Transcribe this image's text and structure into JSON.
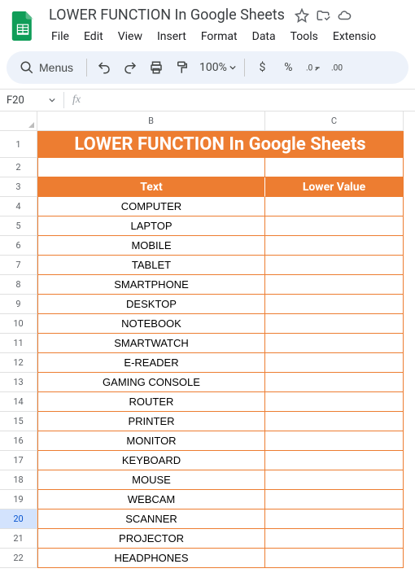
{
  "doc": {
    "title": "LOWER FUNCTION In Google Sheets"
  },
  "menus": {
    "file": "File",
    "edit": "Edit",
    "view": "View",
    "insert": "Insert",
    "format": "Format",
    "data": "Data",
    "tools": "Tools",
    "extensions": "Extensio"
  },
  "toolbar": {
    "search_label": "Menus",
    "zoom": "100%",
    "currency": "$",
    "percent": "%"
  },
  "namebox": {
    "value": "F20",
    "fx": "fx"
  },
  "columns": {
    "B": "B",
    "C": "C"
  },
  "sheet": {
    "title": "LOWER FUNCTION In Google Sheets",
    "header_text": "Text",
    "header_value": "Lower Value",
    "rows": [
      {
        "n": "1"
      },
      {
        "n": "2"
      },
      {
        "n": "3"
      },
      {
        "n": "4",
        "text": "COMPUTER",
        "value": ""
      },
      {
        "n": "5",
        "text": "LAPTOP",
        "value": ""
      },
      {
        "n": "6",
        "text": "MOBILE",
        "value": ""
      },
      {
        "n": "7",
        "text": "TABLET",
        "value": ""
      },
      {
        "n": "8",
        "text": "SMARTPHONE",
        "value": ""
      },
      {
        "n": "9",
        "text": "DESKTOP",
        "value": ""
      },
      {
        "n": "10",
        "text": "NOTEBOOK",
        "value": ""
      },
      {
        "n": "11",
        "text": "SMARTWATCH",
        "value": ""
      },
      {
        "n": "12",
        "text": "E-READER",
        "value": ""
      },
      {
        "n": "13",
        "text": "GAMING CONSOLE",
        "value": ""
      },
      {
        "n": "14",
        "text": "ROUTER",
        "value": ""
      },
      {
        "n": "15",
        "text": "PRINTER",
        "value": ""
      },
      {
        "n": "16",
        "text": "MONITOR",
        "value": ""
      },
      {
        "n": "17",
        "text": "KEYBOARD",
        "value": ""
      },
      {
        "n": "18",
        "text": "MOUSE",
        "value": ""
      },
      {
        "n": "19",
        "text": "WEBCAM",
        "value": ""
      },
      {
        "n": "20",
        "text": "SCANNER",
        "value": ""
      },
      {
        "n": "21",
        "text": "PROJECTOR",
        "value": ""
      },
      {
        "n": "22",
        "text": "HEADPHONES",
        "value": ""
      }
    ]
  },
  "selected_row": "20"
}
